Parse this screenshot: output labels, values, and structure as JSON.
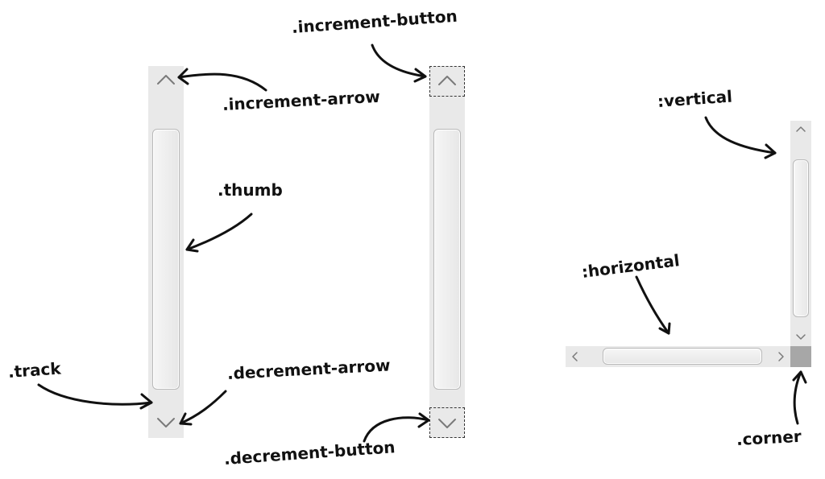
{
  "labels": {
    "increment_button": ".increment-button",
    "increment_arrow": ".increment-arrow",
    "thumb": ".thumb",
    "track": ".track",
    "decrement_arrow": ".decrement-arrow",
    "decrement_button": ".decrement-button",
    "vertical": ":vertical",
    "horizontal": ":horizontal",
    "corner": ".corner"
  },
  "icons": {
    "up": "chevron-up-icon",
    "down": "chevron-down-icon",
    "left": "chevron-left-icon",
    "right": "chevron-right-icon"
  },
  "colors": {
    "track": "#e9e9e9",
    "corner": "#a7a7a7",
    "outline": "#333333"
  }
}
